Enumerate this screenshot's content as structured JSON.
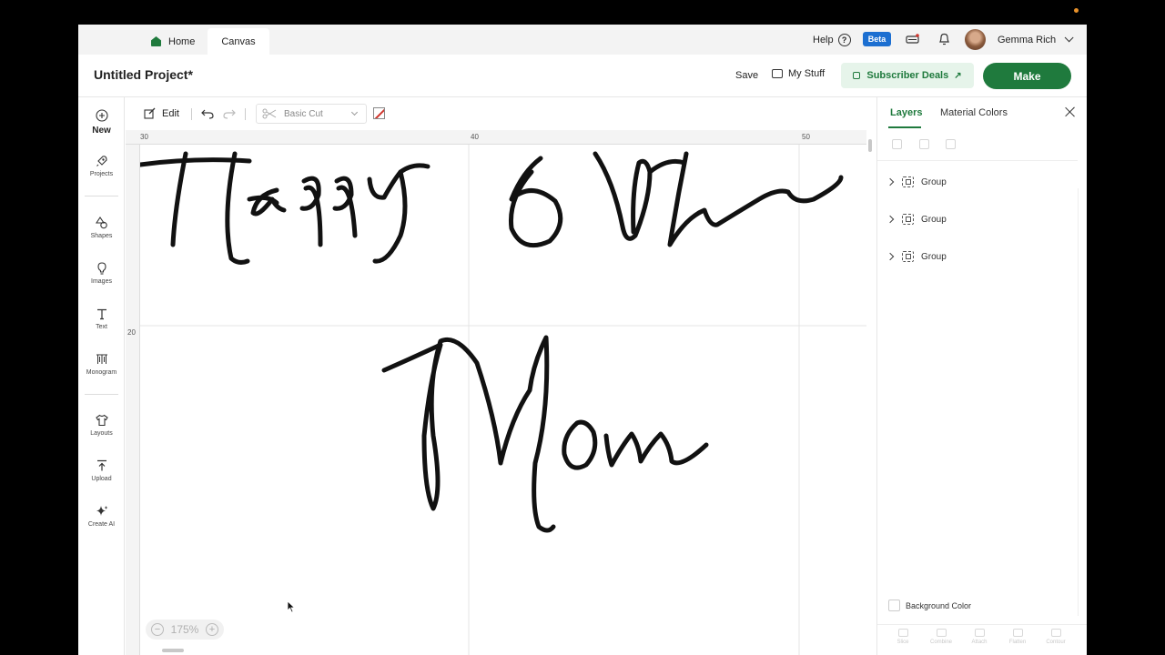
{
  "topnav": {
    "tabs": [
      {
        "label": "Home"
      },
      {
        "label": "Canvas"
      }
    ],
    "help_label": "Help",
    "beta_label": "Beta",
    "user_name": "Gemma Rich"
  },
  "project": {
    "title": "Untitled Project*",
    "save_label": "Save",
    "mystuff_label": "My Stuff",
    "deals_label": "Subscriber Deals",
    "make_label": "Make"
  },
  "sidebar": {
    "items": [
      {
        "label": "New",
        "icon": "plus-circle-icon"
      },
      {
        "label": "Projects",
        "icon": "rocket-icon"
      },
      {
        "label": "Shapes",
        "icon": "shapes-icon"
      },
      {
        "label": "Images",
        "icon": "bulb-icon"
      },
      {
        "label": "Text",
        "icon": "text-icon"
      },
      {
        "label": "Monogram",
        "icon": "monogram-icon"
      },
      {
        "label": "Layouts",
        "icon": "shirt-icon"
      },
      {
        "label": "Upload",
        "icon": "upload-icon"
      },
      {
        "label": "Create AI",
        "icon": "sparkle-icon"
      }
    ]
  },
  "toolbar": {
    "edit_label": "Edit",
    "operation_value": "Basic Cut"
  },
  "canvas": {
    "ruler_top": [
      "30",
      "40",
      "50"
    ],
    "ruler_left": [
      "20"
    ],
    "design_text": [
      "Happy 60th",
      "Mom"
    ],
    "zoom": "175%"
  },
  "panel": {
    "tabs": [
      {
        "label": "Layers"
      },
      {
        "label": "Material Colors"
      }
    ],
    "layers": [
      {
        "label": "Group"
      },
      {
        "label": "Group"
      },
      {
        "label": "Group"
      }
    ],
    "background_label": "Background Color",
    "bottom_actions": [
      "Slice",
      "Combine",
      "Attach",
      "Flatten",
      "Contour"
    ]
  },
  "colors": {
    "brand_green": "#1f7a3d",
    "beta_blue": "#1c6fd1"
  }
}
